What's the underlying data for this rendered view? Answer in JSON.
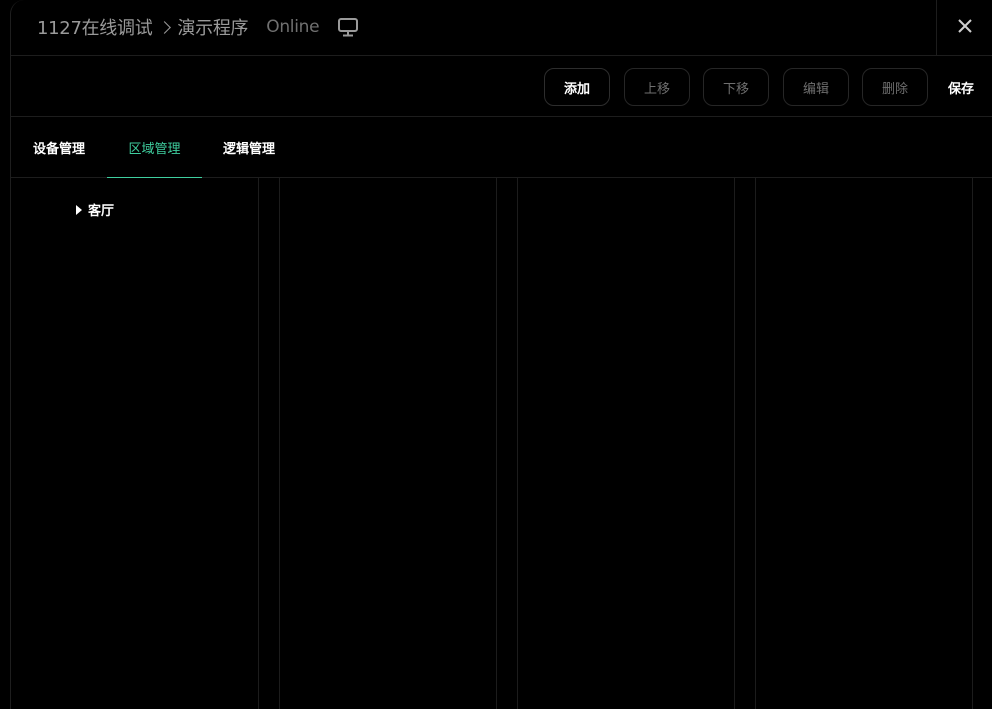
{
  "header": {
    "project": "1127在线调试",
    "program": "演示程序",
    "status": "Online",
    "icons": {
      "device": "monitor-icon",
      "close": "close-icon",
      "separator": "chevron-right-icon"
    }
  },
  "toolbar": {
    "add": "添加",
    "move_up": "上移",
    "move_down": "下移",
    "edit": "编辑",
    "delete": "删除",
    "save": "保存"
  },
  "tabs": [
    {
      "label": "设备管理",
      "selected": false
    },
    {
      "label": "区域管理",
      "selected": true
    },
    {
      "label": "逻辑管理",
      "selected": false
    }
  ],
  "tree": {
    "items": [
      {
        "label": "客厅",
        "expanded": false,
        "icon": "caret-right-icon"
      }
    ]
  },
  "colors": {
    "accent": "#3fcf9f",
    "background": "#000000",
    "border": "#1d1d1d",
    "muted_text": "#6f6f6f"
  }
}
